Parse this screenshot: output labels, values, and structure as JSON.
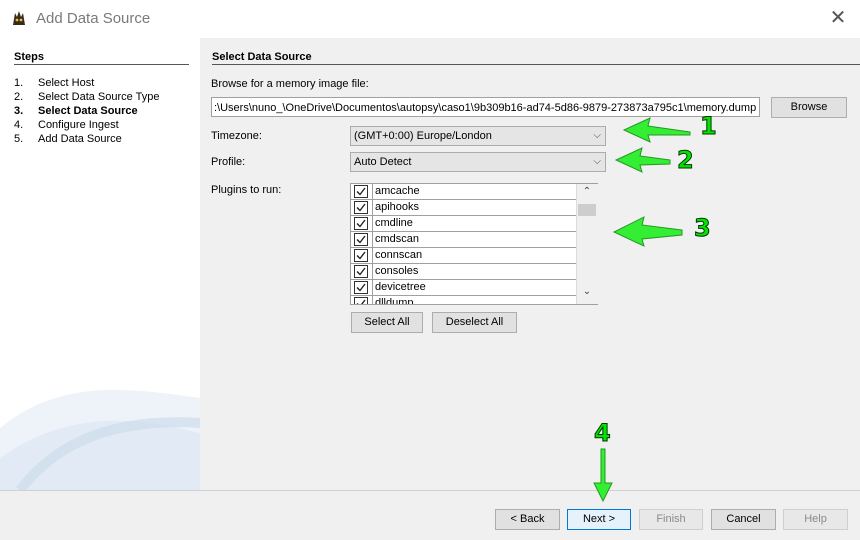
{
  "window": {
    "title": "Add Data Source",
    "close_icon": "close-icon"
  },
  "steps": {
    "heading": "Steps",
    "items": [
      {
        "num": "1.",
        "label": "Select Host"
      },
      {
        "num": "2.",
        "label": "Select Data Source Type"
      },
      {
        "num": "3.",
        "label": "Select Data Source",
        "active": true
      },
      {
        "num": "4.",
        "label": "Configure Ingest"
      },
      {
        "num": "5.",
        "label": "Add Data Source"
      }
    ]
  },
  "main": {
    "heading": "Select Data Source",
    "browse_label": "Browse for a memory image file:",
    "path_value": ":\\Users\\nuno_\\OneDrive\\Documentos\\autopsy\\caso1\\9b309b16-ad74-5d86-9879-273873a795c1\\memory.dump",
    "browse_button": "Browse",
    "timezone_label": "Timezone:",
    "timezone_value": "(GMT+0:00) Europe/London",
    "profile_label": "Profile:",
    "profile_value": "Auto Detect",
    "plugins_label": "Plugins to run:",
    "plugins": [
      {
        "name": "amcache",
        "checked": true
      },
      {
        "name": "apihooks",
        "checked": true
      },
      {
        "name": "cmdline",
        "checked": true
      },
      {
        "name": "cmdscan",
        "checked": true
      },
      {
        "name": "connscan",
        "checked": true
      },
      {
        "name": "consoles",
        "checked": true
      },
      {
        "name": "devicetree",
        "checked": true
      },
      {
        "name": "dlldump",
        "checked": true
      }
    ],
    "select_all": "Select All",
    "deselect_all": "Deselect All"
  },
  "footer": {
    "back": "< Back",
    "next": "Next >",
    "finish": "Finish",
    "cancel": "Cancel",
    "help": "Help"
  },
  "annotations": {
    "color": "#33ee33",
    "labels": [
      "1",
      "2",
      "3",
      "4"
    ]
  }
}
